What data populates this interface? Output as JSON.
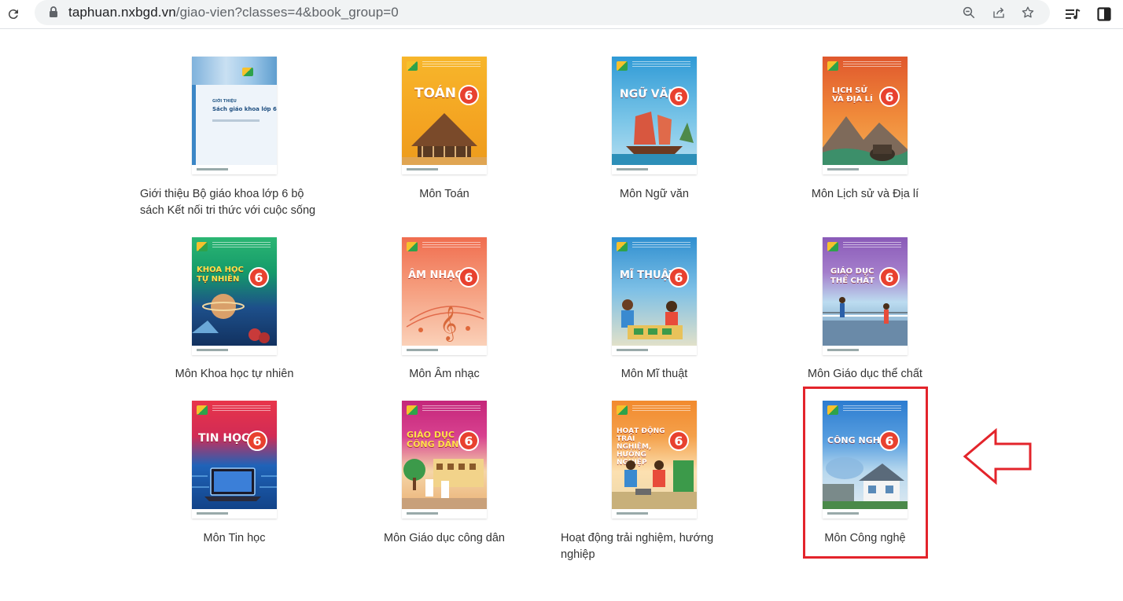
{
  "browser": {
    "url_host": "taphuan.nxbgd.vn",
    "url_path": "/giao-vien?classes=4&book_group=0"
  },
  "books": [
    {
      "caption": "Giới thiệu Bộ giáo khoa lớp 6 bộ sách Kết nối tri thức với cuộc sống",
      "cover_title": "Sách giáo khoa lớp 6",
      "cover_kicker": "GIỚI THIỆU"
    },
    {
      "caption": "Môn Toán",
      "cover_title": "TOÁN",
      "grade": "6"
    },
    {
      "caption": "Môn Ngữ văn",
      "cover_title": "NGỮ VĂN",
      "grade": "6"
    },
    {
      "caption": "Môn Lịch sử và Địa lí",
      "cover_title": "LỊCH SỬ VÀ ĐỊA LÍ",
      "grade": "6"
    },
    {
      "caption": "Môn Khoa học tự nhiên",
      "cover_title": "KHOA HỌC TỰ NHIÊN",
      "grade": "6"
    },
    {
      "caption": "Môn Âm nhạc",
      "cover_title": "ÂM NHẠC",
      "grade": "6"
    },
    {
      "caption": "Môn Mĩ thuật",
      "cover_title": "MĨ THUẬT",
      "grade": "6"
    },
    {
      "caption": "Môn Giáo dục thể chất",
      "cover_title": "GIÁO DỤC THỂ CHẤT",
      "grade": "6"
    },
    {
      "caption": "Môn Tin học",
      "cover_title": "TIN HỌC",
      "grade": "6"
    },
    {
      "caption": "Môn Giáo dục công dân",
      "cover_title": "GIÁO DỤC CÔNG DÂN",
      "grade": "6"
    },
    {
      "caption": "Hoạt động trải nghiệm, hướng nghiệp",
      "cover_title": "HOẠT ĐỘNG TRẢI NGHIỆM, HƯỚNG NGHIỆP",
      "grade": "6"
    },
    {
      "caption": "Môn Công nghệ",
      "cover_title": "CÔNG NGHỆ",
      "grade": "6"
    }
  ],
  "annotation": {
    "highlight_color": "#e3242b"
  },
  "colors": {
    "toolbar_bg": "#ffffff",
    "omnibox_bg": "#f1f3f4",
    "caption_text": "#333333"
  }
}
